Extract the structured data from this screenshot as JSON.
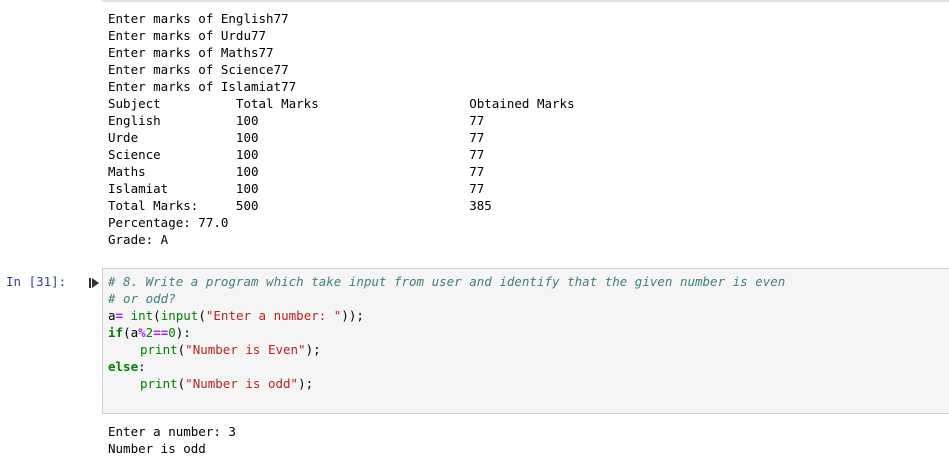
{
  "output_top": [
    "Enter marks of English77",
    "Enter marks of Urdu77",
    "Enter marks of Maths77",
    "Enter marks of Science77",
    "Enter marks of Islamiat77",
    "Subject          Total Marks                    Obtained Marks",
    "English          100                            77",
    "Urde             100                            77",
    "Science          100                            77",
    "Maths            100                            77",
    "Islamiat         100                            77",
    "Total Marks:     500                            385",
    "Percentage: 77.0",
    "Grade: A"
  ],
  "cell": {
    "prompt": "In [31]:",
    "comment1": "# 8. Write a program which take input from user and identify that the given number is even",
    "comment2": "# or odd?",
    "l3_var": "a",
    "l3_eq": "=",
    "l3_int": "int",
    "l3_open": "(",
    "l3_input": "input",
    "l3_open2": "(",
    "l3_str": "\"Enter a number: \"",
    "l3_close": "));",
    "l4_if": "if",
    "l4_open": "(",
    "l4_a": "a",
    "l4_mod": "%",
    "l4_two": "2",
    "l4_eq": "==",
    "l4_zero": "0",
    "l4_close": "):",
    "l5_print": "print",
    "l5_open": "(",
    "l5_str": "\"Number is Even\"",
    "l5_close": ");",
    "l6_else": "else",
    "l6_colon": ":",
    "l7_print": "print",
    "l7_open": "(",
    "l7_str": "\"Number is odd\"",
    "l7_close": ");"
  },
  "output_bottom": [
    "Enter a number: 3",
    "Number is odd"
  ]
}
